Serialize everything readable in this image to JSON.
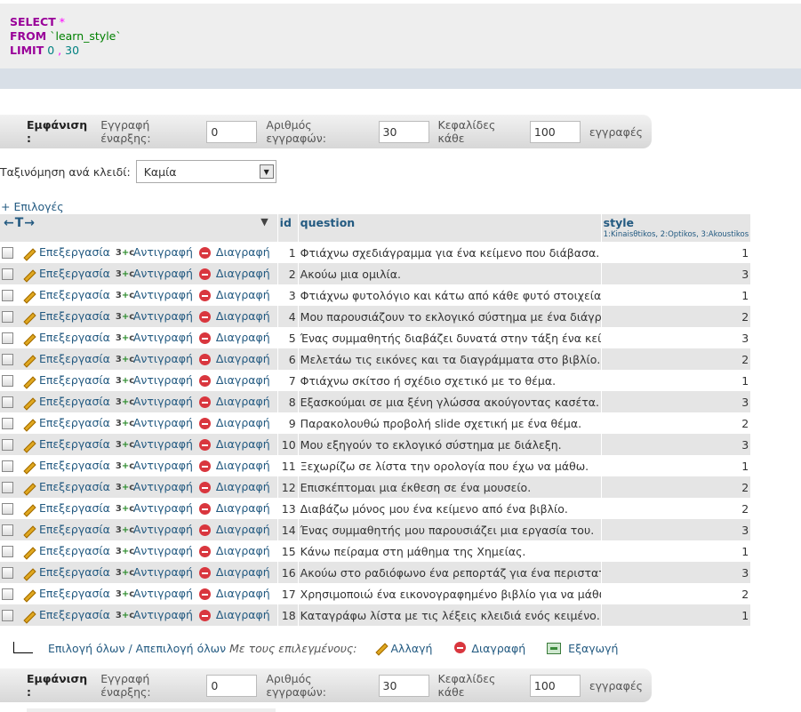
{
  "sql": {
    "select_kw": "SELECT",
    "star": "*",
    "from_kw": "FROM",
    "table": "`learn_style`",
    "limit_kw": "LIMIT",
    "offset": "0",
    "comma": ",",
    "count": "30"
  },
  "nav": {
    "show_label": "Εμφάνιση :",
    "start_label": "Εγγραφή έναρξης:",
    "start_value": "0",
    "rows_label": "Αριθμός εγγραφών:",
    "rows_value": "30",
    "headers_label": "Κεφαλίδες κάθε",
    "headers_value": "100",
    "records_label": "εγγραφές"
  },
  "sort": {
    "label": "Ταξινόμηση ανά κλειδί:",
    "value": "Καμία"
  },
  "options_link": "+ Επιλογές",
  "table": {
    "arrows": "←T→",
    "sort_indicator": "▼",
    "columns": {
      "id": "id",
      "question": "question",
      "style": "style",
      "style_comment": "1:Kinaisθtikos, 2:Optikos, 3:Akoustikos"
    },
    "actions": {
      "edit": "Επεξεργασία",
      "copy": "Αντιγραφή",
      "delete": "Διαγραφή"
    },
    "rows": [
      {
        "id": "1",
        "question": "Φτιάχνω σχεδιάγραμμα για ένα κείμενο που διάβασα.",
        "style": "1"
      },
      {
        "id": "2",
        "question": "Ακούω μια ομιλία.",
        "style": "3"
      },
      {
        "id": "3",
        "question": "Φτιάχνω φυτολόγιο και κάτω από κάθε φυτό στοιχεία...",
        "style": "1"
      },
      {
        "id": "4",
        "question": "Μου παρουσιάζουν το εκλογικό σύστημα με ένα διάγρα...",
        "style": "2"
      },
      {
        "id": "5",
        "question": "Ένας συμμαθητής διαβάζει δυνατά στην τάξη ένα κεί...",
        "style": "3"
      },
      {
        "id": "6",
        "question": "Μελετάω τις εικόνες και τα διαγράμματα στο βιβλίο.",
        "style": "2"
      },
      {
        "id": "7",
        "question": "Φτιάχνω σκίτσο ή σχέδιο σχετικό με το θέμα.",
        "style": "1"
      },
      {
        "id": "8",
        "question": "Εξασκούμαι σε μια ξένη γλώσσα ακούγοντας κασέτα.",
        "style": "3"
      },
      {
        "id": "9",
        "question": "Παρακολουθώ προβολή slide σχετική με ένα θέμα.",
        "style": "2"
      },
      {
        "id": "10",
        "question": "Μου εξηγούν το εκλογικό σύστημα με διάλεξη.",
        "style": "3"
      },
      {
        "id": "11",
        "question": "Ξεχωρίζω σε λίστα την ορολογία που έχω να μάθω.",
        "style": "1"
      },
      {
        "id": "12",
        "question": "Επισκέπτομαι μια έκθεση σε ένα μουσείο.",
        "style": "2"
      },
      {
        "id": "13",
        "question": "Διαβάζω μόνος μου ένα κείμενο από ένα βιβλίο.",
        "style": "2"
      },
      {
        "id": "14",
        "question": "Ένας συμμαθητής μου παρουσιάζει μια εργασία του.",
        "style": "3"
      },
      {
        "id": "15",
        "question": "Κάνω πείραμα στη μάθημα της Χημείας.",
        "style": "1"
      },
      {
        "id": "16",
        "question": "Ακούω στο ραδιόφωνο ένα ρεπορτάζ για ένα περιστατι...",
        "style": "3"
      },
      {
        "id": "17",
        "question": "Χρησιμοποιώ ένα εικονογραφημένο βιβλίο για να μάθω...",
        "style": "2"
      },
      {
        "id": "18",
        "question": "Καταγράφω λίστα με τις λέξεις κλειδιά ενός κειμένο...",
        "style": "1"
      }
    ]
  },
  "bottom": {
    "select_all": "Επιλογή όλων / Απεπιλογή όλων",
    "with_selected": "Με τους επιλεγμένους:",
    "change": "Αλλαγή",
    "delete": "Διαγραφή",
    "export": "Εξαγωγή"
  }
}
